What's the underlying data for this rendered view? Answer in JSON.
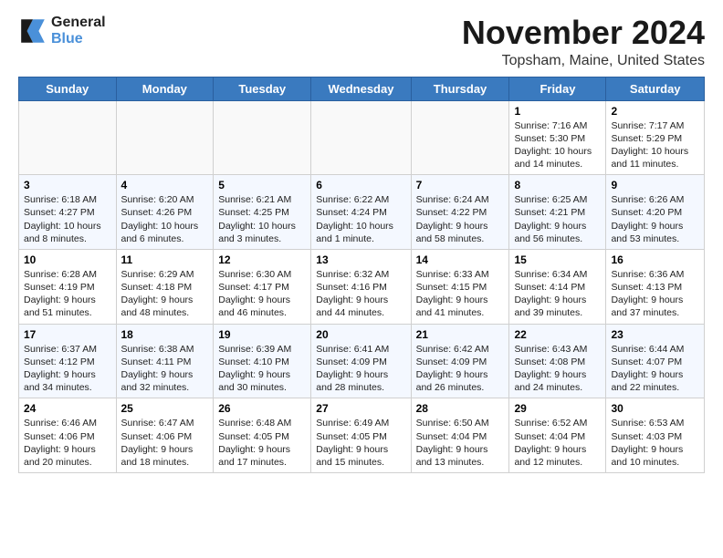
{
  "logo": {
    "line1": "General",
    "line2": "Blue"
  },
  "title": "November 2024",
  "location": "Topsham, Maine, United States",
  "days_of_week": [
    "Sunday",
    "Monday",
    "Tuesday",
    "Wednesday",
    "Thursday",
    "Friday",
    "Saturday"
  ],
  "weeks": [
    [
      {
        "day": "",
        "info": ""
      },
      {
        "day": "",
        "info": ""
      },
      {
        "day": "",
        "info": ""
      },
      {
        "day": "",
        "info": ""
      },
      {
        "day": "",
        "info": ""
      },
      {
        "day": "1",
        "info": "Sunrise: 7:16 AM\nSunset: 5:30 PM\nDaylight: 10 hours and 14 minutes."
      },
      {
        "day": "2",
        "info": "Sunrise: 7:17 AM\nSunset: 5:29 PM\nDaylight: 10 hours and 11 minutes."
      }
    ],
    [
      {
        "day": "3",
        "info": "Sunrise: 6:18 AM\nSunset: 4:27 PM\nDaylight: 10 hours and 8 minutes."
      },
      {
        "day": "4",
        "info": "Sunrise: 6:20 AM\nSunset: 4:26 PM\nDaylight: 10 hours and 6 minutes."
      },
      {
        "day": "5",
        "info": "Sunrise: 6:21 AM\nSunset: 4:25 PM\nDaylight: 10 hours and 3 minutes."
      },
      {
        "day": "6",
        "info": "Sunrise: 6:22 AM\nSunset: 4:24 PM\nDaylight: 10 hours and 1 minute."
      },
      {
        "day": "7",
        "info": "Sunrise: 6:24 AM\nSunset: 4:22 PM\nDaylight: 9 hours and 58 minutes."
      },
      {
        "day": "8",
        "info": "Sunrise: 6:25 AM\nSunset: 4:21 PM\nDaylight: 9 hours and 56 minutes."
      },
      {
        "day": "9",
        "info": "Sunrise: 6:26 AM\nSunset: 4:20 PM\nDaylight: 9 hours and 53 minutes."
      }
    ],
    [
      {
        "day": "10",
        "info": "Sunrise: 6:28 AM\nSunset: 4:19 PM\nDaylight: 9 hours and 51 minutes."
      },
      {
        "day": "11",
        "info": "Sunrise: 6:29 AM\nSunset: 4:18 PM\nDaylight: 9 hours and 48 minutes."
      },
      {
        "day": "12",
        "info": "Sunrise: 6:30 AM\nSunset: 4:17 PM\nDaylight: 9 hours and 46 minutes."
      },
      {
        "day": "13",
        "info": "Sunrise: 6:32 AM\nSunset: 4:16 PM\nDaylight: 9 hours and 44 minutes."
      },
      {
        "day": "14",
        "info": "Sunrise: 6:33 AM\nSunset: 4:15 PM\nDaylight: 9 hours and 41 minutes."
      },
      {
        "day": "15",
        "info": "Sunrise: 6:34 AM\nSunset: 4:14 PM\nDaylight: 9 hours and 39 minutes."
      },
      {
        "day": "16",
        "info": "Sunrise: 6:36 AM\nSunset: 4:13 PM\nDaylight: 9 hours and 37 minutes."
      }
    ],
    [
      {
        "day": "17",
        "info": "Sunrise: 6:37 AM\nSunset: 4:12 PM\nDaylight: 9 hours and 34 minutes."
      },
      {
        "day": "18",
        "info": "Sunrise: 6:38 AM\nSunset: 4:11 PM\nDaylight: 9 hours and 32 minutes."
      },
      {
        "day": "19",
        "info": "Sunrise: 6:39 AM\nSunset: 4:10 PM\nDaylight: 9 hours and 30 minutes."
      },
      {
        "day": "20",
        "info": "Sunrise: 6:41 AM\nSunset: 4:09 PM\nDaylight: 9 hours and 28 minutes."
      },
      {
        "day": "21",
        "info": "Sunrise: 6:42 AM\nSunset: 4:09 PM\nDaylight: 9 hours and 26 minutes."
      },
      {
        "day": "22",
        "info": "Sunrise: 6:43 AM\nSunset: 4:08 PM\nDaylight: 9 hours and 24 minutes."
      },
      {
        "day": "23",
        "info": "Sunrise: 6:44 AM\nSunset: 4:07 PM\nDaylight: 9 hours and 22 minutes."
      }
    ],
    [
      {
        "day": "24",
        "info": "Sunrise: 6:46 AM\nSunset: 4:06 PM\nDaylight: 9 hours and 20 minutes."
      },
      {
        "day": "25",
        "info": "Sunrise: 6:47 AM\nSunset: 4:06 PM\nDaylight: 9 hours and 18 minutes."
      },
      {
        "day": "26",
        "info": "Sunrise: 6:48 AM\nSunset: 4:05 PM\nDaylight: 9 hours and 17 minutes."
      },
      {
        "day": "27",
        "info": "Sunrise: 6:49 AM\nSunset: 4:05 PM\nDaylight: 9 hours and 15 minutes."
      },
      {
        "day": "28",
        "info": "Sunrise: 6:50 AM\nSunset: 4:04 PM\nDaylight: 9 hours and 13 minutes."
      },
      {
        "day": "29",
        "info": "Sunrise: 6:52 AM\nSunset: 4:04 PM\nDaylight: 9 hours and 12 minutes."
      },
      {
        "day": "30",
        "info": "Sunrise: 6:53 AM\nSunset: 4:03 PM\nDaylight: 9 hours and 10 minutes."
      }
    ]
  ]
}
